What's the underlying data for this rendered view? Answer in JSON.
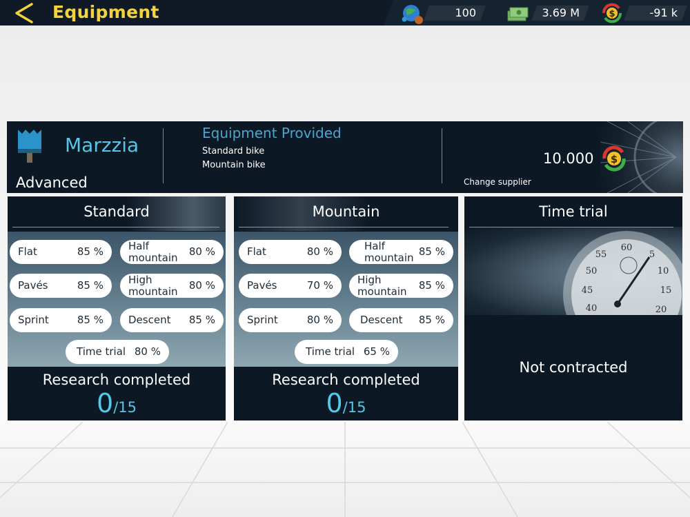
{
  "header": {
    "title": "Equipment",
    "stats": [
      {
        "icon": "globe-icon",
        "value": "100"
      },
      {
        "icon": "cash-stack-icon",
        "value": "3.69 M"
      },
      {
        "icon": "balance-dollar-icon",
        "value": "-91 k"
      }
    ]
  },
  "supplier": {
    "name": "Marzzia",
    "level": "Advanced",
    "equipment_title": "Equipment Provided",
    "equipment": [
      "Standard bike",
      "Mountain bike"
    ],
    "cost": "10.000",
    "change_label": "Change supplier"
  },
  "cards": [
    {
      "title": "Standard",
      "stats": {
        "flat": {
          "label": "Flat",
          "value": "85 %"
        },
        "half_mountain": {
          "label": "Half mountain",
          "line1": "Half",
          "line2": "mountain",
          "value": "80 %"
        },
        "paves": {
          "label": "Pavés",
          "value": "85 %"
        },
        "high_mountain": {
          "label": "High mountain",
          "line1": "High",
          "line2": "mountain",
          "value": "80 %"
        },
        "sprint": {
          "label": "Sprint",
          "value": "85 %"
        },
        "descent": {
          "label": "Descent",
          "value": "85 %"
        },
        "time_trial": {
          "label": "Time trial",
          "value": "80 %"
        }
      },
      "research_label": "Research completed",
      "research_done": "0",
      "research_total": "/15"
    },
    {
      "title": "Mountain",
      "stats": {
        "flat": {
          "label": "Flat",
          "value": "80 %"
        },
        "half_mountain": {
          "label": "Half mountain",
          "line1": "Half",
          "line2": "mountain",
          "value": "85 %"
        },
        "paves": {
          "label": "Pavés",
          "value": "70 %"
        },
        "high_mountain": {
          "label": "High mountain",
          "line1": "High",
          "line2": "mountain",
          "value": "85 %"
        },
        "sprint": {
          "label": "Sprint",
          "value": "80 %"
        },
        "descent": {
          "label": "Descent",
          "value": "85 %"
        },
        "time_trial": {
          "label": "Time trial",
          "value": "65 %"
        }
      },
      "research_label": "Research completed",
      "research_done": "0",
      "research_total": "/15"
    },
    {
      "title": "Time trial",
      "status": "Not contracted"
    }
  ],
  "colors": {
    "accent_yellow": "#f3d33b",
    "accent_blue": "#55c7e8",
    "panel": "#0d1825"
  }
}
